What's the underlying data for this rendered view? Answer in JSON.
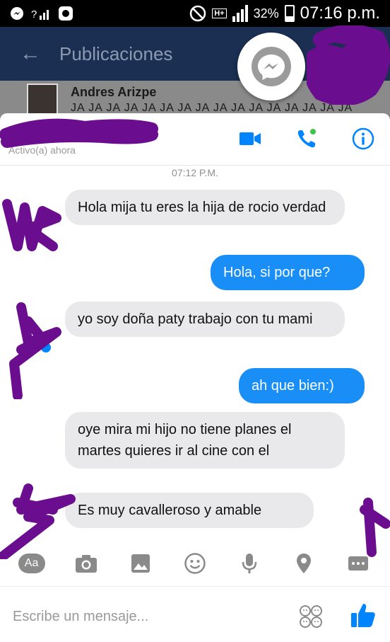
{
  "status_bar": {
    "network_type": "H+",
    "battery": "32%",
    "battery_level": 0.32,
    "time": "07:16 p.m."
  },
  "background_app": {
    "title": "Publicaciones",
    "post_author": "Andres Arizpe",
    "post_text": "JA JA JA JA JA JA JA JA JA JA JA JA JA JA JA JA"
  },
  "chat": {
    "active_status": "Activo(a) ahora",
    "timestamp": "07:12 P.M.",
    "messages": [
      {
        "dir": "in",
        "text": "Hola mija tu eres la hija de rocio verdad"
      },
      {
        "dir": "out",
        "text": "Hola, si por que?"
      },
      {
        "dir": "in",
        "text": "yo soy doña paty trabajo con tu mami"
      },
      {
        "dir": "out",
        "text": "ah que bien:)"
      },
      {
        "dir": "in",
        "text": "oye mira mi hijo no tiene planes el martes quieres ir al cine con el"
      },
      {
        "dir": "in",
        "text": "Es muy cavalleroso y amable"
      }
    ]
  },
  "toolbar": {
    "aa_label": "Aa",
    "icons": [
      "camera-icon",
      "image-icon",
      "emoji-icon",
      "microphone-icon",
      "location-icon",
      "more-icon"
    ]
  },
  "composer": {
    "placeholder": "Escribe un mensaje...",
    "value": ""
  },
  "colors": {
    "messenger_blue": "#1a8ef7",
    "incoming_bubble": "#e9e9eb",
    "censor_purple": "#6a0d8f",
    "header_icon_blue": "#0084ff",
    "call_dot_green": "#3ec24a"
  }
}
